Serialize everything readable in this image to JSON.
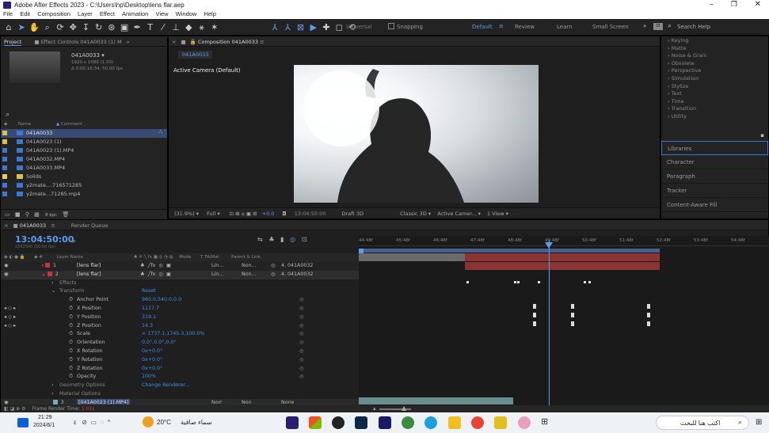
{
  "window": {
    "title": "Adobe After Effects 2023 - C:\\Users\\hp\\Desktop\\lens flar.aep"
  },
  "menu": [
    "File",
    "Edit",
    "Composition",
    "Layer",
    "Effect",
    "Animation",
    "View",
    "Window",
    "Help"
  ],
  "toolbar": {
    "universal": "Universal",
    "snapping": "Snapping",
    "workspaces": [
      "Default",
      "Review",
      "Learn",
      "Small Screen"
    ],
    "search_placeholder": "Search Help"
  },
  "project": {
    "tab": "Project",
    "effect_controls_tab": "Effect Controls 041A0033 (1) M",
    "item_name": "041A0033 ▾",
    "item_info1": "1920 x 1080 (1.00)",
    "item_info2": "Δ 0:00:16:34, 50.00 fps",
    "col_name": "Name",
    "col_comment": "Comment",
    "bpc": "8 bpc",
    "items": [
      {
        "name": "041A0033",
        "color": "#d8c24a",
        "icon": "comp-icon",
        "selected": true
      },
      {
        "name": "041A0023 (1)",
        "color": "#d8c24a",
        "icon": "comp-icon"
      },
      {
        "name": "041A0023 (1).MP4",
        "color": "#3a78d8",
        "icon": "footage-icon"
      },
      {
        "name": "041A0032.MP4",
        "color": "#3a78d8",
        "icon": "footage-icon"
      },
      {
        "name": "041A0033.MP4",
        "color": "#3a78d8",
        "icon": "footage-icon"
      },
      {
        "name": "Solids",
        "color": "#e8d24a",
        "icon": "folder-icon"
      },
      {
        "name": "y2mate....716571285",
        "color": "#3a78d8",
        "icon": "footage-icon"
      },
      {
        "name": "y2mate...71285.mp4",
        "color": "#3a78d8",
        "icon": "footage-icon"
      }
    ]
  },
  "composition": {
    "tab": "Composition 041A0033",
    "subtab": "041A0033",
    "camera": "Active Camera (Default)",
    "footer": {
      "zoom": "(31.9%)",
      "res": "Full",
      "exposure": "+0.0",
      "time": "13:04:50:00",
      "draft": "Draft 3D",
      "renderer": "Classic 3D",
      "camera": "Active Camer...",
      "views": "1 View"
    }
  },
  "right_panel": {
    "effects": [
      "Keying",
      "Matte",
      "Noise & Grain",
      "Obsolete",
      "Perspective",
      "Simulation",
      "Stylize",
      "Text",
      "Time",
      "Transition",
      "Utility"
    ],
    "panels": [
      "Libraries",
      "Character",
      "Paragraph",
      "Tracker",
      "Content-Aware Fill"
    ]
  },
  "timeline": {
    "tab": "041A0033",
    "render_queue": "Render Queue",
    "timecode": "13:04:50:00",
    "timecode_sub": "2352500 (50.00 fps)",
    "ruler": [
      "44:48f",
      "45:48f",
      "46:48f",
      "47:48f",
      "48:48f",
      "49:48f",
      "50:48f",
      "51:48f",
      "52:48f",
      "53:48f",
      "54:48f"
    ],
    "cols": {
      "layer_name": "Layer Name",
      "mode": "Mode",
      "trkmat": "T  TrkMat",
      "parent": "Parent & Link"
    },
    "layers": [
      {
        "num": "1",
        "name": "[lens flar]",
        "mode": "Lin…",
        "trk": "Non…",
        "parent": "4. 041A0032"
      },
      {
        "num": "2",
        "name": "[lens flar]",
        "mode": "Lin…",
        "trk": "Non…",
        "parent": "4. 041A0032"
      }
    ],
    "props": [
      {
        "name": "Effects",
        "value": "",
        "indent": 1
      },
      {
        "name": "Transform",
        "value": "Reset",
        "indent": 1
      },
      {
        "name": "Anchor Point",
        "value": "960.0,540.0,0.0",
        "indent": 2
      },
      {
        "name": "X Position",
        "value": "1117.7",
        "indent": 2,
        "kf": true
      },
      {
        "name": "Y Position",
        "value": "319.1",
        "indent": 2,
        "kf": true
      },
      {
        "name": "Z Position",
        "value": "14.3",
        "indent": 2,
        "kf": true
      },
      {
        "name": "Scale",
        "value": "∞ 1737.1,1745.3,100.0%",
        "indent": 2
      },
      {
        "name": "Orientation",
        "value": "0.0°,0.0°,0.0°",
        "indent": 2
      },
      {
        "name": "X Rotation",
        "value": "0x+0.0°",
        "indent": 2
      },
      {
        "name": "Y Rotation",
        "value": "0x+0.0°",
        "indent": 2
      },
      {
        "name": "Z Rotation",
        "value": "0x+0.0°",
        "indent": 2
      },
      {
        "name": "Opacity",
        "value": "100%",
        "indent": 2
      },
      {
        "name": "Geometry Options",
        "value": "Change Renderer...",
        "indent": 1
      },
      {
        "name": "Material Options",
        "value": "",
        "indent": 1
      }
    ],
    "layer3": {
      "num": "3",
      "name": "[041A0023 (1).MP4]",
      "mode": "Norr",
      "trk": "Non",
      "parent": "None"
    },
    "frame_render": "Frame Render Time:",
    "frame_render_val": "1.01s"
  },
  "taskbar": {
    "time": "21:29",
    "date": "2024/6/1",
    "temp": "20°C",
    "weather": "سماء صافية",
    "search": "اكتب هنا للبحث"
  }
}
